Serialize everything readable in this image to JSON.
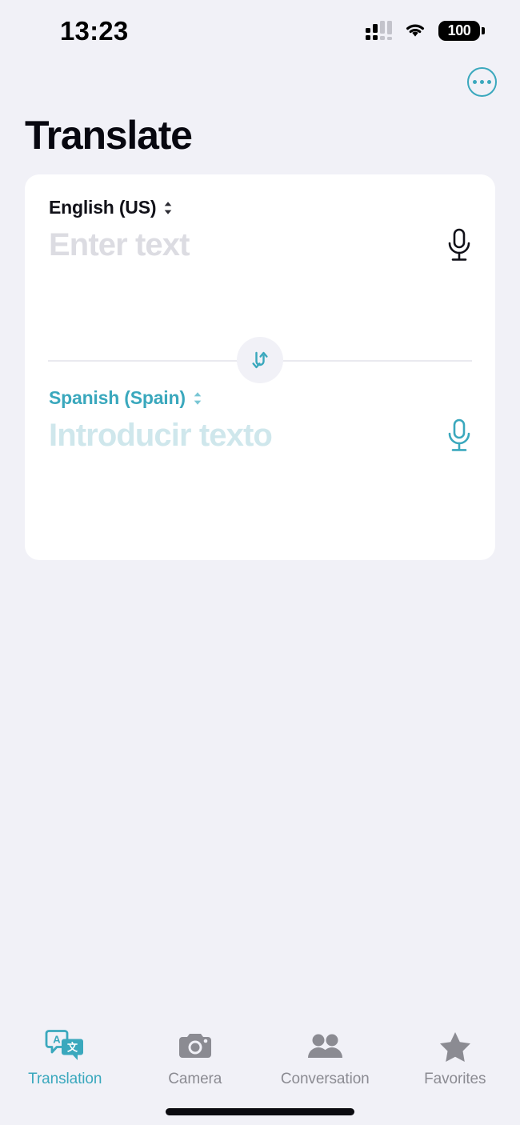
{
  "status_bar": {
    "time": "13:23",
    "signal_icon": "cellular-signal-icon",
    "wifi_icon": "wifi-icon",
    "battery_level": "100"
  },
  "header": {
    "more_button_label": "more-options",
    "title": "Translate"
  },
  "translate_card": {
    "source": {
      "language": "English (US)",
      "placeholder": "Enter text",
      "mic_label": "microphone"
    },
    "swap_label": "swap-languages",
    "target": {
      "language": "Spanish (Spain)",
      "placeholder": "Introducir texto",
      "mic_label": "microphone"
    }
  },
  "tab_bar": {
    "items": [
      {
        "label": "Translation",
        "icon": "translation-bubbles-icon",
        "active": true
      },
      {
        "label": "Camera",
        "icon": "camera-icon",
        "active": false
      },
      {
        "label": "Conversation",
        "icon": "people-icon",
        "active": false
      },
      {
        "label": "Favorites",
        "icon": "star-icon",
        "active": false
      }
    ]
  },
  "colors": {
    "accent": "#3aa8bd",
    "background": "#f1f1f7",
    "card": "#ffffff",
    "placeholder_source": "#dcdce2",
    "placeholder_target": "#cfe7ec",
    "inactive_tab": "#8b8b92"
  }
}
